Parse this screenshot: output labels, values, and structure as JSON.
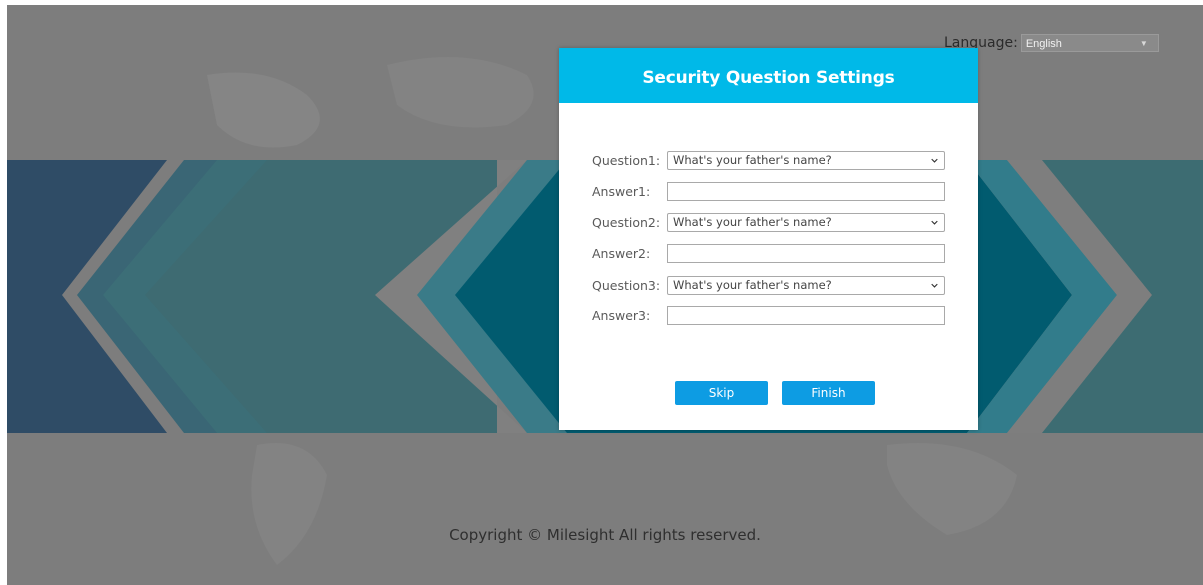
{
  "language": {
    "label": "Language:",
    "selected": "English",
    "arrow": "▼"
  },
  "dialog": {
    "title": "Security Question Settings",
    "rows": [
      {
        "question_label": "Question1:",
        "question_value": "What's your father's name?",
        "answer_label": "Answer1:",
        "answer_value": ""
      },
      {
        "question_label": "Question2:",
        "question_value": "What's your father's name?",
        "answer_label": "Answer2:",
        "answer_value": ""
      },
      {
        "question_label": "Question3:",
        "question_value": "What's your father's name?",
        "answer_label": "Answer3:",
        "answer_value": ""
      }
    ],
    "skip_label": "Skip",
    "finish_label": "Finish"
  },
  "footer": {
    "copyright": "Copyright © Milesight All rights reserved."
  },
  "colors": {
    "header": "#00b9e8",
    "button": "#0d9ce3"
  }
}
